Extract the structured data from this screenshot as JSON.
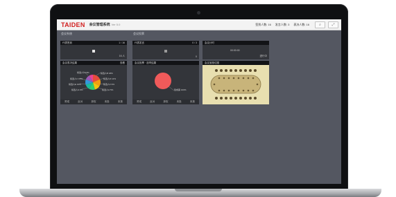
{
  "header": {
    "logo": "TAIDEN",
    "app_title": "会议管理系统",
    "app_subtitle": "Ver 5.0",
    "stats": [
      "签到人数: 16",
      "发言人数: 3",
      "表决人数: 16"
    ],
    "buttons": [
      "⌕",
      "⤢"
    ]
  },
  "groups": [
    {
      "label": "会议系统"
    },
    {
      "label": "会议投票"
    }
  ],
  "panels": {
    "p1": {
      "title": "代表签到",
      "right": "1 / 16",
      "value": "16 人"
    },
    "p2": {
      "title": "代表发言",
      "right": "0 / 3",
      "value": "0"
    },
    "p3": {
      "title": "会议计时",
      "right": "",
      "value": "00:00:00",
      "sub": "进行中"
    },
    "p4": {
      "title": "会议表决结果",
      "right": "查看",
      "foot": [
        "赞成",
        "反对",
        "弃权",
        "未投",
        "未按"
      ]
    },
    "p5": {
      "title": "会议投票 · 选举结果",
      "right": "",
      "foot": [
        "赞成",
        "反对",
        "弃权",
        "未投",
        "未按"
      ]
    },
    "p6": {
      "title": "会议室座位图",
      "right": ""
    }
  },
  "pie1_labels": [
    "候选人A 23%",
    "候选人B 18%",
    "候选人C 15%",
    "候选人D 12%",
    "候选人E 10%",
    "候选人F 9%",
    "候选人G 8%",
    "候选人H 5%"
  ],
  "pie2_label": "赞成票 100%",
  "colors": {
    "screen_bg": "#545761",
    "panel_bg": "#33353a",
    "logo_red": "#d21f1f",
    "pie_red": "#f05a5a",
    "table_bg": "#e8dfb0"
  }
}
